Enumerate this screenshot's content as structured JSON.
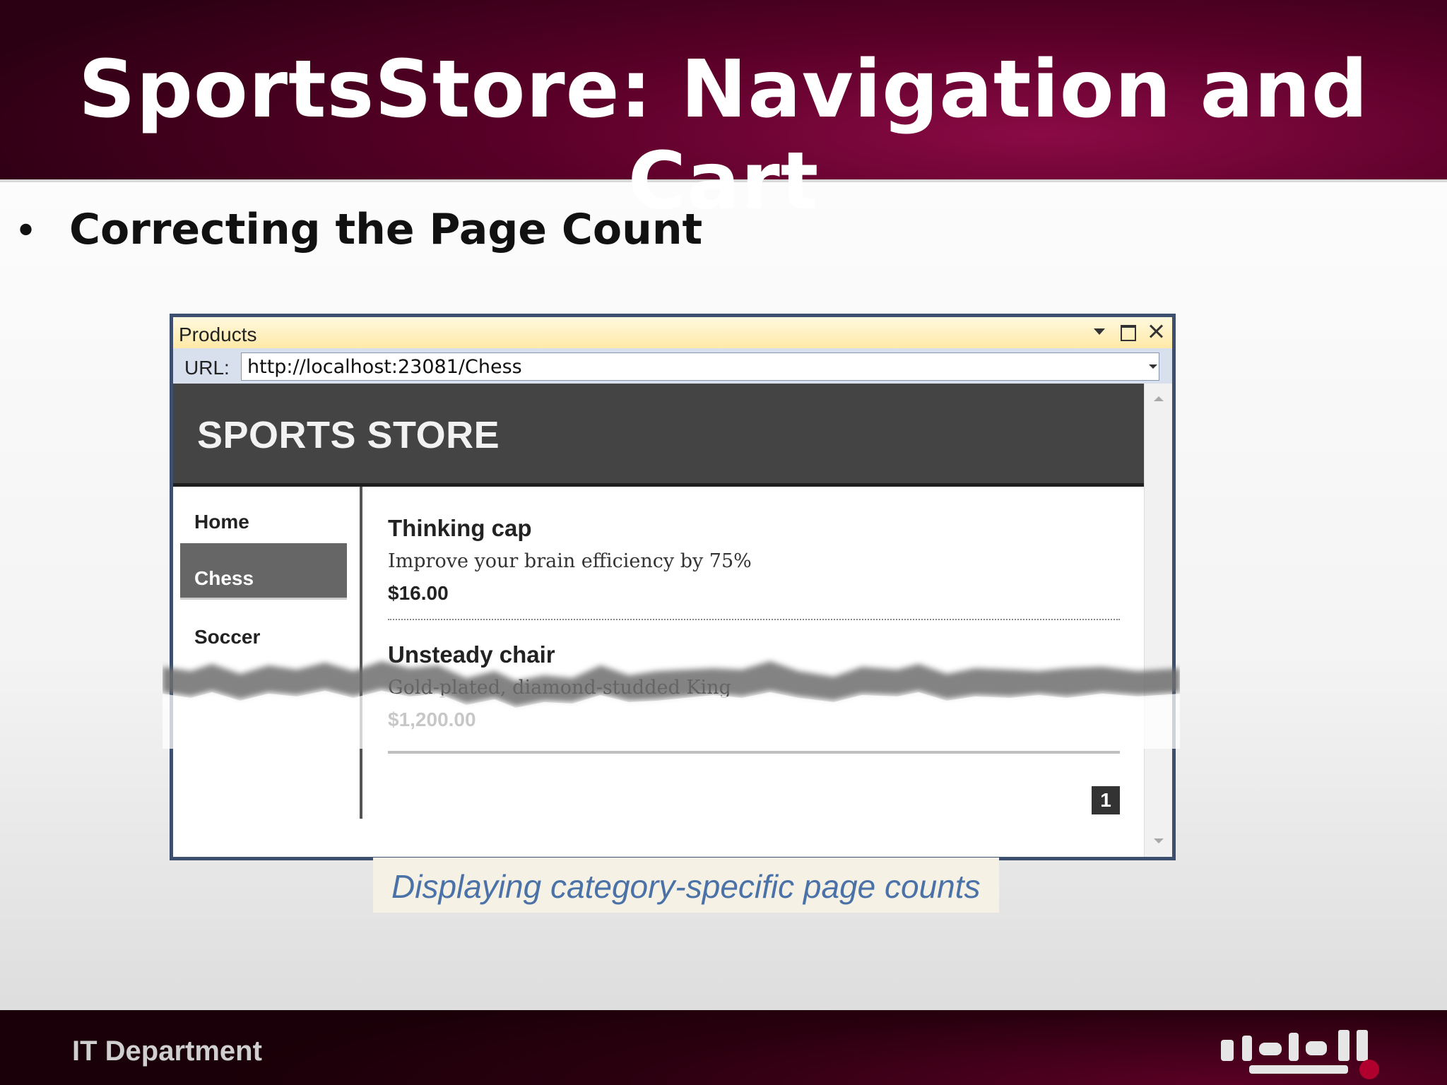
{
  "slide": {
    "title": "SportsStore: Navigation and Cart",
    "bullet": "Correcting the Page Count",
    "caption": "Displaying category-specific page counts",
    "footer": "IT Department"
  },
  "window": {
    "title": "Products",
    "url_label": "URL:",
    "url": "http://localhost:23081/Chess"
  },
  "store": {
    "name": "SPORTS STORE",
    "nav": [
      {
        "label": "Home",
        "selected": false
      },
      {
        "label": "Chess",
        "selected": true
      },
      {
        "label": "Soccer",
        "selected": false
      }
    ],
    "products": [
      {
        "name": "Thinking cap",
        "description": "Improve your brain efficiency by 75%",
        "price": "$16.00"
      },
      {
        "name": "Unsteady chair",
        "description": "Gold-plated, diamond-studded King",
        "price": "$1,200.00"
      }
    ],
    "pager": [
      "1"
    ]
  },
  "colors": {
    "header_maroon": "#5a0028",
    "store_header": "#444444",
    "selected_nav": "#666666",
    "caption_blue": "#4a72a8"
  }
}
